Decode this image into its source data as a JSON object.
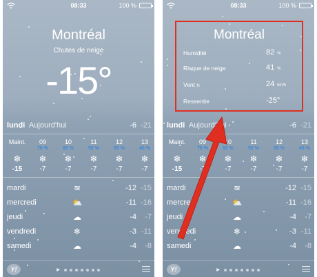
{
  "status": {
    "time": "08:33",
    "battery": "100 %"
  },
  "left": {
    "city": "Montréal",
    "condition": "Chutes de neige",
    "temperature": "-15°",
    "today": {
      "day": "lundi",
      "relative": "Aujourd'hui",
      "high": "-6",
      "low": "-21"
    }
  },
  "right": {
    "city": "Montréal",
    "details": [
      {
        "label": "Humidité",
        "value": "82",
        "unit": "%"
      },
      {
        "label": "Risque de neige",
        "value": "41",
        "unit": "%"
      },
      {
        "label": "Vent",
        "label_suffix": "N",
        "value": "24",
        "unit": "km/h"
      },
      {
        "label": "Ressentie",
        "value": "-25°",
        "unit": ""
      }
    ],
    "today": {
      "day": "lundi",
      "relative": "Aujourd'hui",
      "high": "-6",
      "low": "-21"
    }
  },
  "hourly": [
    {
      "hour": "Maint.",
      "pct": "",
      "icon": "snowflake-icon",
      "temp": "-15"
    },
    {
      "hour": "09",
      "pct": "70 %",
      "icon": "snowflake-icon",
      "temp": "-7"
    },
    {
      "hour": "10",
      "pct": "60 %",
      "icon": "snowflake-icon",
      "temp": "-7"
    },
    {
      "hour": "11",
      "pct": "50 %",
      "icon": "snowflake-icon",
      "temp": "-7"
    },
    {
      "hour": "12",
      "pct": "50 %",
      "icon": "snowflake-icon",
      "temp": "-7"
    },
    {
      "hour": "13",
      "pct": "40 %",
      "icon": "snowflake-icon",
      "temp": "-7"
    }
  ],
  "forecast": [
    {
      "day": "mardi",
      "icon": "wind-icon",
      "high": "-12",
      "low": "-15"
    },
    {
      "day": "mercredi",
      "icon": "sun-cloud-icon",
      "high": "-11",
      "low": "-16"
    },
    {
      "day": "jeudi",
      "icon": "cloud-icon",
      "high": "-4",
      "low": "-7"
    },
    {
      "day": "vendredi",
      "icon": "snowflake-icon",
      "high": "-3",
      "low": "-11"
    },
    {
      "day": "samedi",
      "icon": "cloud-icon",
      "high": "-4",
      "low": "-8"
    }
  ],
  "footer": {
    "yahoo": "Y!"
  },
  "colors": {
    "annotation": "#e02f20",
    "precip": "#3e88d8",
    "battery": "#4cd964"
  }
}
